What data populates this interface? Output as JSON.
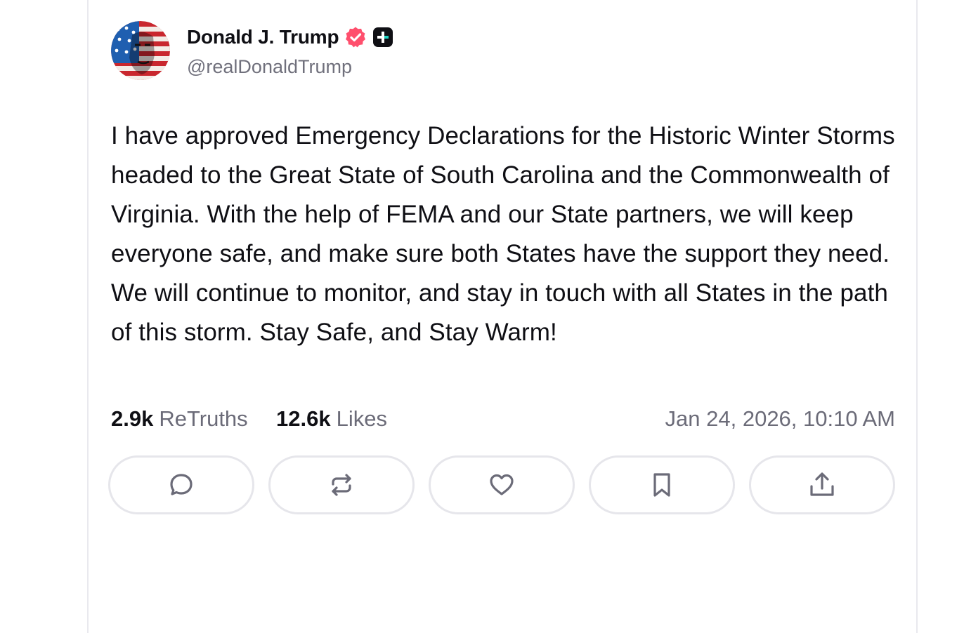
{
  "author": {
    "display_name": "Donald J. Trump",
    "handle": "@realDonaldTrump",
    "verified_icon": "verified-badge-icon",
    "plus_icon": "truth-plus-icon",
    "badge_color": "#ff4f6d"
  },
  "post": {
    "text": "I have approved Emergency Declarations for the Historic Winter Storms headed to the Great State of South Carolina and the Commonwealth of Virginia. With the help of FEMA and our State partners, we will keep everyone safe, and make sure both States have the support they need. We will continue to monitor, and stay in touch with all States in the path of this storm. Stay Safe, and Stay Warm!",
    "retruths_count": "2.9k",
    "retruths_label": "ReTruths",
    "likes_count": "12.6k",
    "likes_label": "Likes",
    "timestamp": "Jan 24, 2026, 10:10 AM"
  },
  "actions": [
    {
      "icon": "reply-icon"
    },
    {
      "icon": "retruth-icon"
    },
    {
      "icon": "like-icon"
    },
    {
      "icon": "bookmark-icon"
    },
    {
      "icon": "share-icon"
    }
  ],
  "colors": {
    "text": "#0f0f14",
    "muted": "#6b6b78",
    "border": "#e6e6eb",
    "icon": "#6b6b78"
  }
}
